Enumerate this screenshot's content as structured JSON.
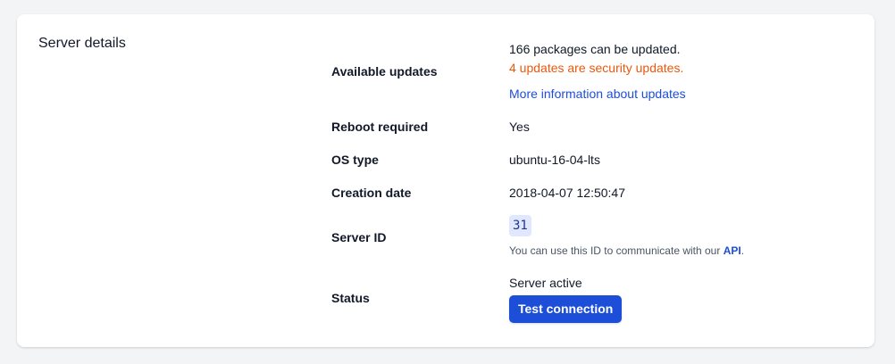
{
  "section": {
    "title": "Server details"
  },
  "updates": {
    "label": "Available updates",
    "packages_text": "166 packages can be updated.",
    "security_text": "4 updates are security updates.",
    "more_info_link": "More information about updates"
  },
  "reboot": {
    "label": "Reboot required",
    "value": "Yes"
  },
  "os": {
    "label": "OS type",
    "value": "ubuntu-16-04-lts"
  },
  "creation": {
    "label": "Creation date",
    "value": "2018-04-07 12:50:47"
  },
  "server_id": {
    "label": "Server ID",
    "value": "31",
    "hint_prefix": "You can use this ID to communicate with our ",
    "hint_link": "API",
    "hint_suffix": "."
  },
  "status": {
    "label": "Status",
    "value": "Server active",
    "button_label": "Test connection"
  },
  "colors": {
    "security": "#ea580c",
    "link": "#1d4ed8",
    "button_bg": "#1d4ed8",
    "badge_bg": "#e0e7ff"
  }
}
